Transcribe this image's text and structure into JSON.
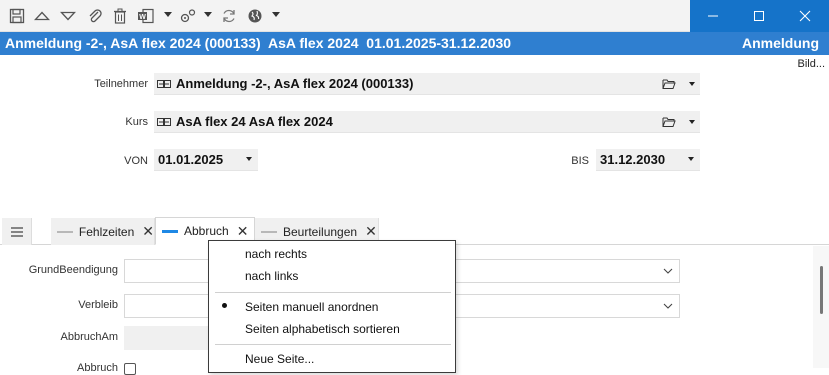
{
  "toolbar": {
    "icons": [
      "save-icon",
      "move-up-icon",
      "move-down-icon",
      "attachment-icon",
      "delete-icon",
      "word-document-icon",
      "tools-icon",
      "refresh-icon",
      "globe-icon"
    ]
  },
  "window": {
    "controls": [
      "minimize",
      "maximize",
      "close"
    ]
  },
  "caption": {
    "title": "Anmeldung -2-, AsA flex 2024 (000133)  AsA flex 2024  01.01.2025-31.12.2030",
    "right": "Anmeldung"
  },
  "bild_link": "Bild...",
  "form": {
    "teilnehmer_label": "Teilnehmer",
    "teilnehmer_value": "Anmeldung -2-, AsA flex 2024 (000133)",
    "kurs_label": "Kurs",
    "kurs_value": "AsA flex 24 AsA flex 2024",
    "von_label": "VON",
    "von_value": "01.01.2025",
    "bis_label": "BIS",
    "bis_value": "31.12.2030"
  },
  "tabs": [
    {
      "label": "Fehlzeiten",
      "active": false
    },
    {
      "label": "Abbruch",
      "active": true
    },
    {
      "label": "Beurteilungen",
      "active": false
    }
  ],
  "panel": {
    "grund_label": "GrundBeendigung",
    "verbleib_label": "Verbleib",
    "abbruch_am_label": "AbbruchAm",
    "partial_label": "Abbruch"
  },
  "context_menu": {
    "items": [
      {
        "label": "nach rechts",
        "checked": false
      },
      {
        "label": "nach links",
        "checked": false
      },
      {
        "label": "Seiten manuell anordnen",
        "checked": true
      },
      {
        "label": "Seiten alphabetisch sortieren",
        "checked": false
      },
      {
        "label": "Neue Seite...",
        "checked": false
      }
    ]
  },
  "colors": {
    "caption_blue": "#2f7fd0",
    "window_controls_blue": "#1573c9",
    "active_tab_accent": "#1e88e5"
  }
}
